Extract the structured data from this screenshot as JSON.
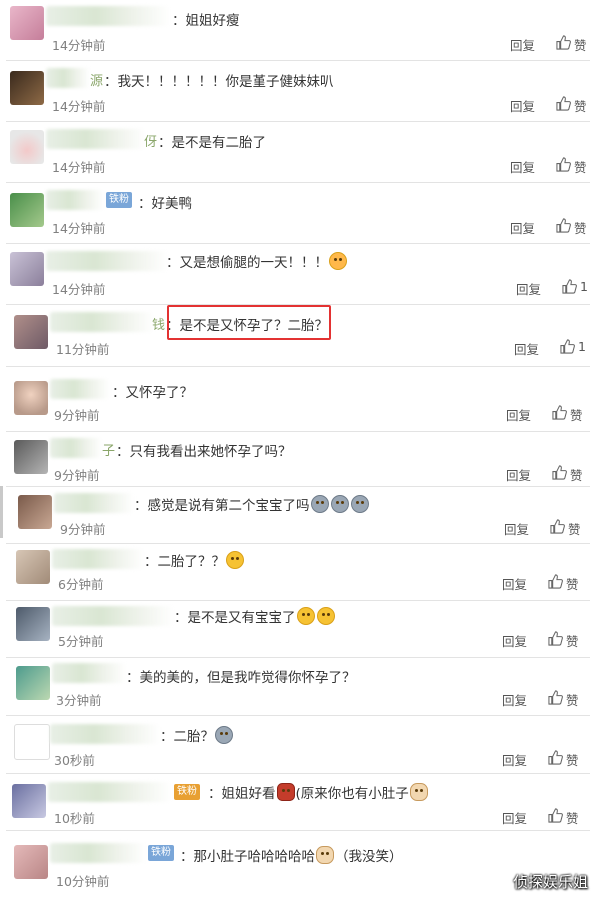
{
  "comments": [
    {
      "name_tail": "",
      "badge": "",
      "text": "：姐姐好瘦",
      "emojis": [],
      "time": "14分钟前",
      "reply": "回复",
      "like": "赞"
    },
    {
      "name_tail": "源",
      "badge": "",
      "text": "：我天！！！！！！你是堇子健妹妹叭",
      "emojis": [],
      "time": "14分钟前",
      "reply": "回复",
      "like": "赞"
    },
    {
      "name_tail": "伢",
      "badge": "",
      "text": "：是不是有二胎了",
      "emojis": [],
      "time": "14分钟前",
      "reply": "回复",
      "like": "赞"
    },
    {
      "name_tail": "",
      "badge": "铁粉",
      "text": "：好美鸭",
      "emojis": [],
      "time": "14分钟前",
      "reply": "回复",
      "like": "赞"
    },
    {
      "name_tail": "",
      "badge": "",
      "text": "：又是想偷腿的一天！！！",
      "emojis": [
        "face2"
      ],
      "time": "14分钟前",
      "reply": "回复",
      "like": "1"
    },
    {
      "name_tail": "钱",
      "badge": "",
      "text": "：是不是又怀孕了？二胎？",
      "emojis": [],
      "time": "11分钟前",
      "reply": "回复",
      "like": "1"
    },
    {
      "name_tail": "",
      "badge": "",
      "text": "：又怀孕了？",
      "emojis": [],
      "time": "9分钟前",
      "reply": "回复",
      "like": "赞"
    },
    {
      "name_tail": "子",
      "badge": "",
      "text": "：只有我看出来她怀孕了吗？",
      "emojis": [],
      "time": "9分钟前",
      "reply": "回复",
      "like": "赞"
    },
    {
      "name_tail": "",
      "badge": "",
      "text": "：感觉是说有第二个宝宝了吗",
      "emojis": [
        "cry",
        "cry",
        "cry"
      ],
      "time": "9分钟前",
      "reply": "回复",
      "like": "赞"
    },
    {
      "name_tail": "",
      "badge": "",
      "text": "：二胎了？？",
      "emojis": [
        "face"
      ],
      "time": "6分钟前",
      "reply": "回复",
      "like": "赞"
    },
    {
      "name_tail": "",
      "badge": "",
      "text": "：是不是又有宝宝了",
      "emojis": [
        "face",
        "face"
      ],
      "time": "5分钟前",
      "reply": "回复",
      "like": "赞"
    },
    {
      "name_tail": "",
      "badge": "",
      "text": "：美的美的，但是我咋觉得你怀孕了？",
      "emojis": [],
      "time": "3分钟前",
      "reply": "回复",
      "like": "赞"
    },
    {
      "name_tail": "",
      "badge": "",
      "text": "：二胎？",
      "emojis": [
        "cry"
      ],
      "time": "30秒前",
      "reply": "回复",
      "like": "赞"
    },
    {
      "name_tail": "",
      "badge": "铁粉",
      "text": "：姐姐好看",
      "text2": "(原来你也有小肚子",
      "emojis": [
        "bag"
      ],
      "emojis2": [
        "cat"
      ],
      "time": "10秒前",
      "reply": "回复",
      "like": "赞"
    },
    {
      "name_tail": "",
      "badge": "铁粉",
      "text": "：那小肚子哈哈哈哈哈",
      "text2": "（我没笑）",
      "emojis": [
        "cat"
      ],
      "time": "10分钟前",
      "reply": "回复",
      "like": ""
    }
  ],
  "watermark": "侦探娱乐姐",
  "colors": {
    "highlight": "#e33232",
    "badge": "#7aa6d8",
    "iron_badge": "#e8a033"
  }
}
